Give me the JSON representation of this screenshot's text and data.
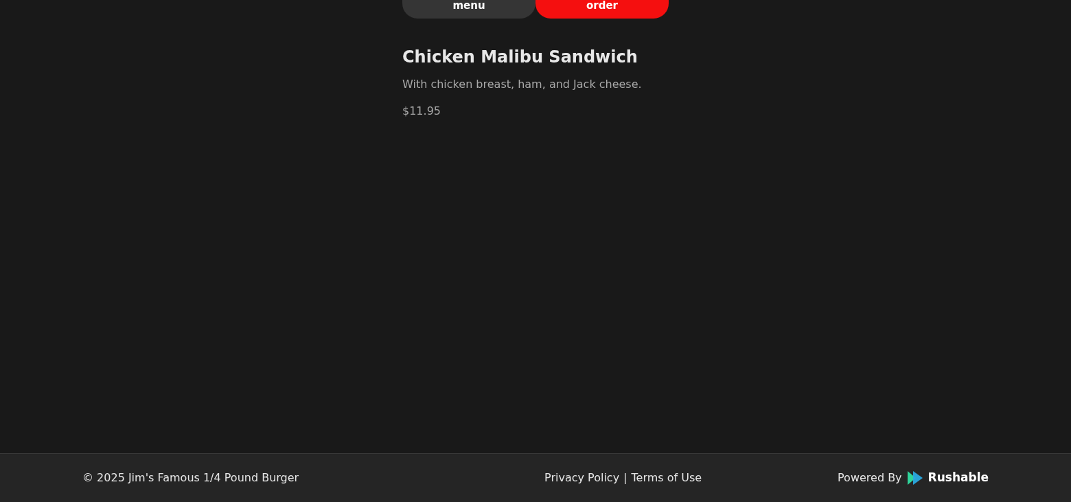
{
  "action_buttons": [
    {
      "label": "menu",
      "kind": "secondary"
    },
    {
      "label": "order",
      "kind": "primary"
    }
  ],
  "item": {
    "name": "Chicken Malibu Sandwich",
    "description": "With chicken breast, ham, and Jack cheese.",
    "price": "$11.95"
  },
  "footer": {
    "copyright": "© 2025 Jim's Famous 1/4 Pound Burger",
    "links": [
      "Privacy Policy",
      "Terms of Use"
    ],
    "separator": "|",
    "powered_by": "Powered By",
    "brand": "Rushable"
  }
}
